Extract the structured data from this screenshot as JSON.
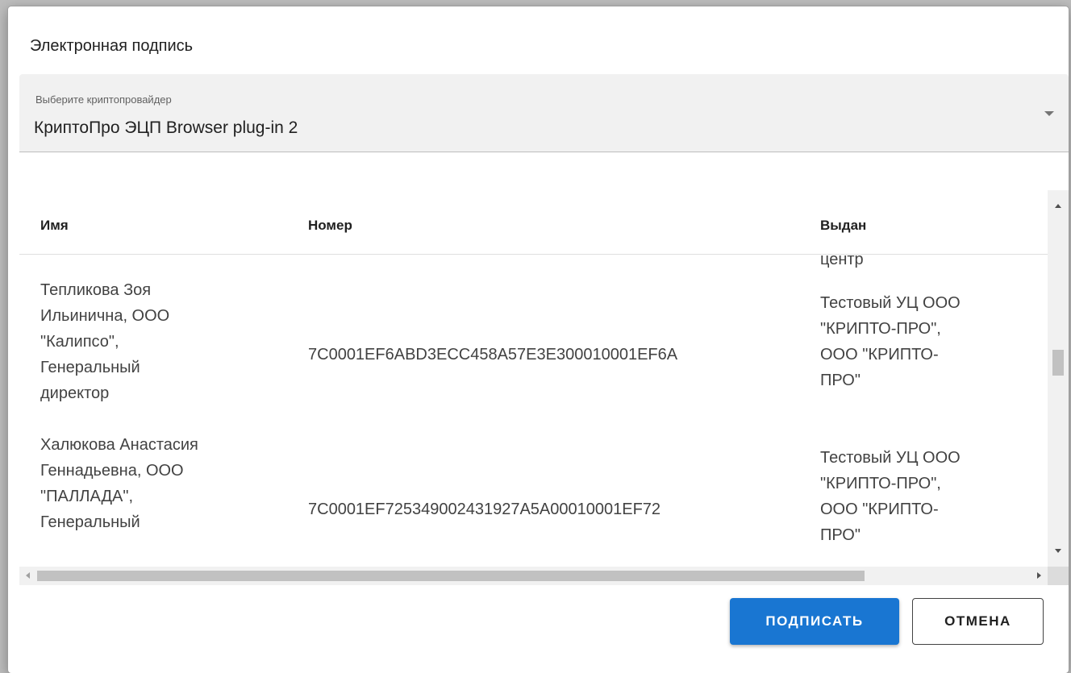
{
  "dialog": {
    "title": "Электронная подпись"
  },
  "provider_select": {
    "label": "Выберите криптопровайдер",
    "value": "КриптоПро ЭЦП Browser plug-in 2",
    "icon": "dropdown-arrow-icon"
  },
  "table": {
    "columns": [
      "Имя",
      "Номер",
      "Выдан"
    ],
    "partial_top_text": "центр",
    "rows": [
      {
        "name_lines": [
          "Тепликова Зоя",
          "Ильинична, ООО",
          "\"Калипсо\",",
          "Генеральный",
          "директор"
        ],
        "number": "7C0001EF6ABD3ECC458A57E3E300010001EF6A",
        "issuer_lines": [
          "Тестовый УЦ ООО",
          "\"КРИПТО-ПРО\",",
          "ООО \"КРИПТО-",
          "ПРО\""
        ]
      },
      {
        "name_lines": [
          "Халюкова Анастасия",
          "Геннадьевна, ООО",
          "\"ПАЛЛАДА\",",
          "Генеральный"
        ],
        "number": "7C0001EF725349002431927A5A00010001EF72",
        "issuer_lines": [
          "Тестовый УЦ ООО",
          "\"КРИПТО-ПРО\",",
          "ООО \"КРИПТО-",
          "ПРО\""
        ]
      }
    ]
  },
  "buttons": {
    "sign": "ПОДПИСАТЬ",
    "cancel": "ОТМЕНА"
  },
  "colors": {
    "primary": "#1976d2",
    "select_bg": "#f1f1f1"
  }
}
